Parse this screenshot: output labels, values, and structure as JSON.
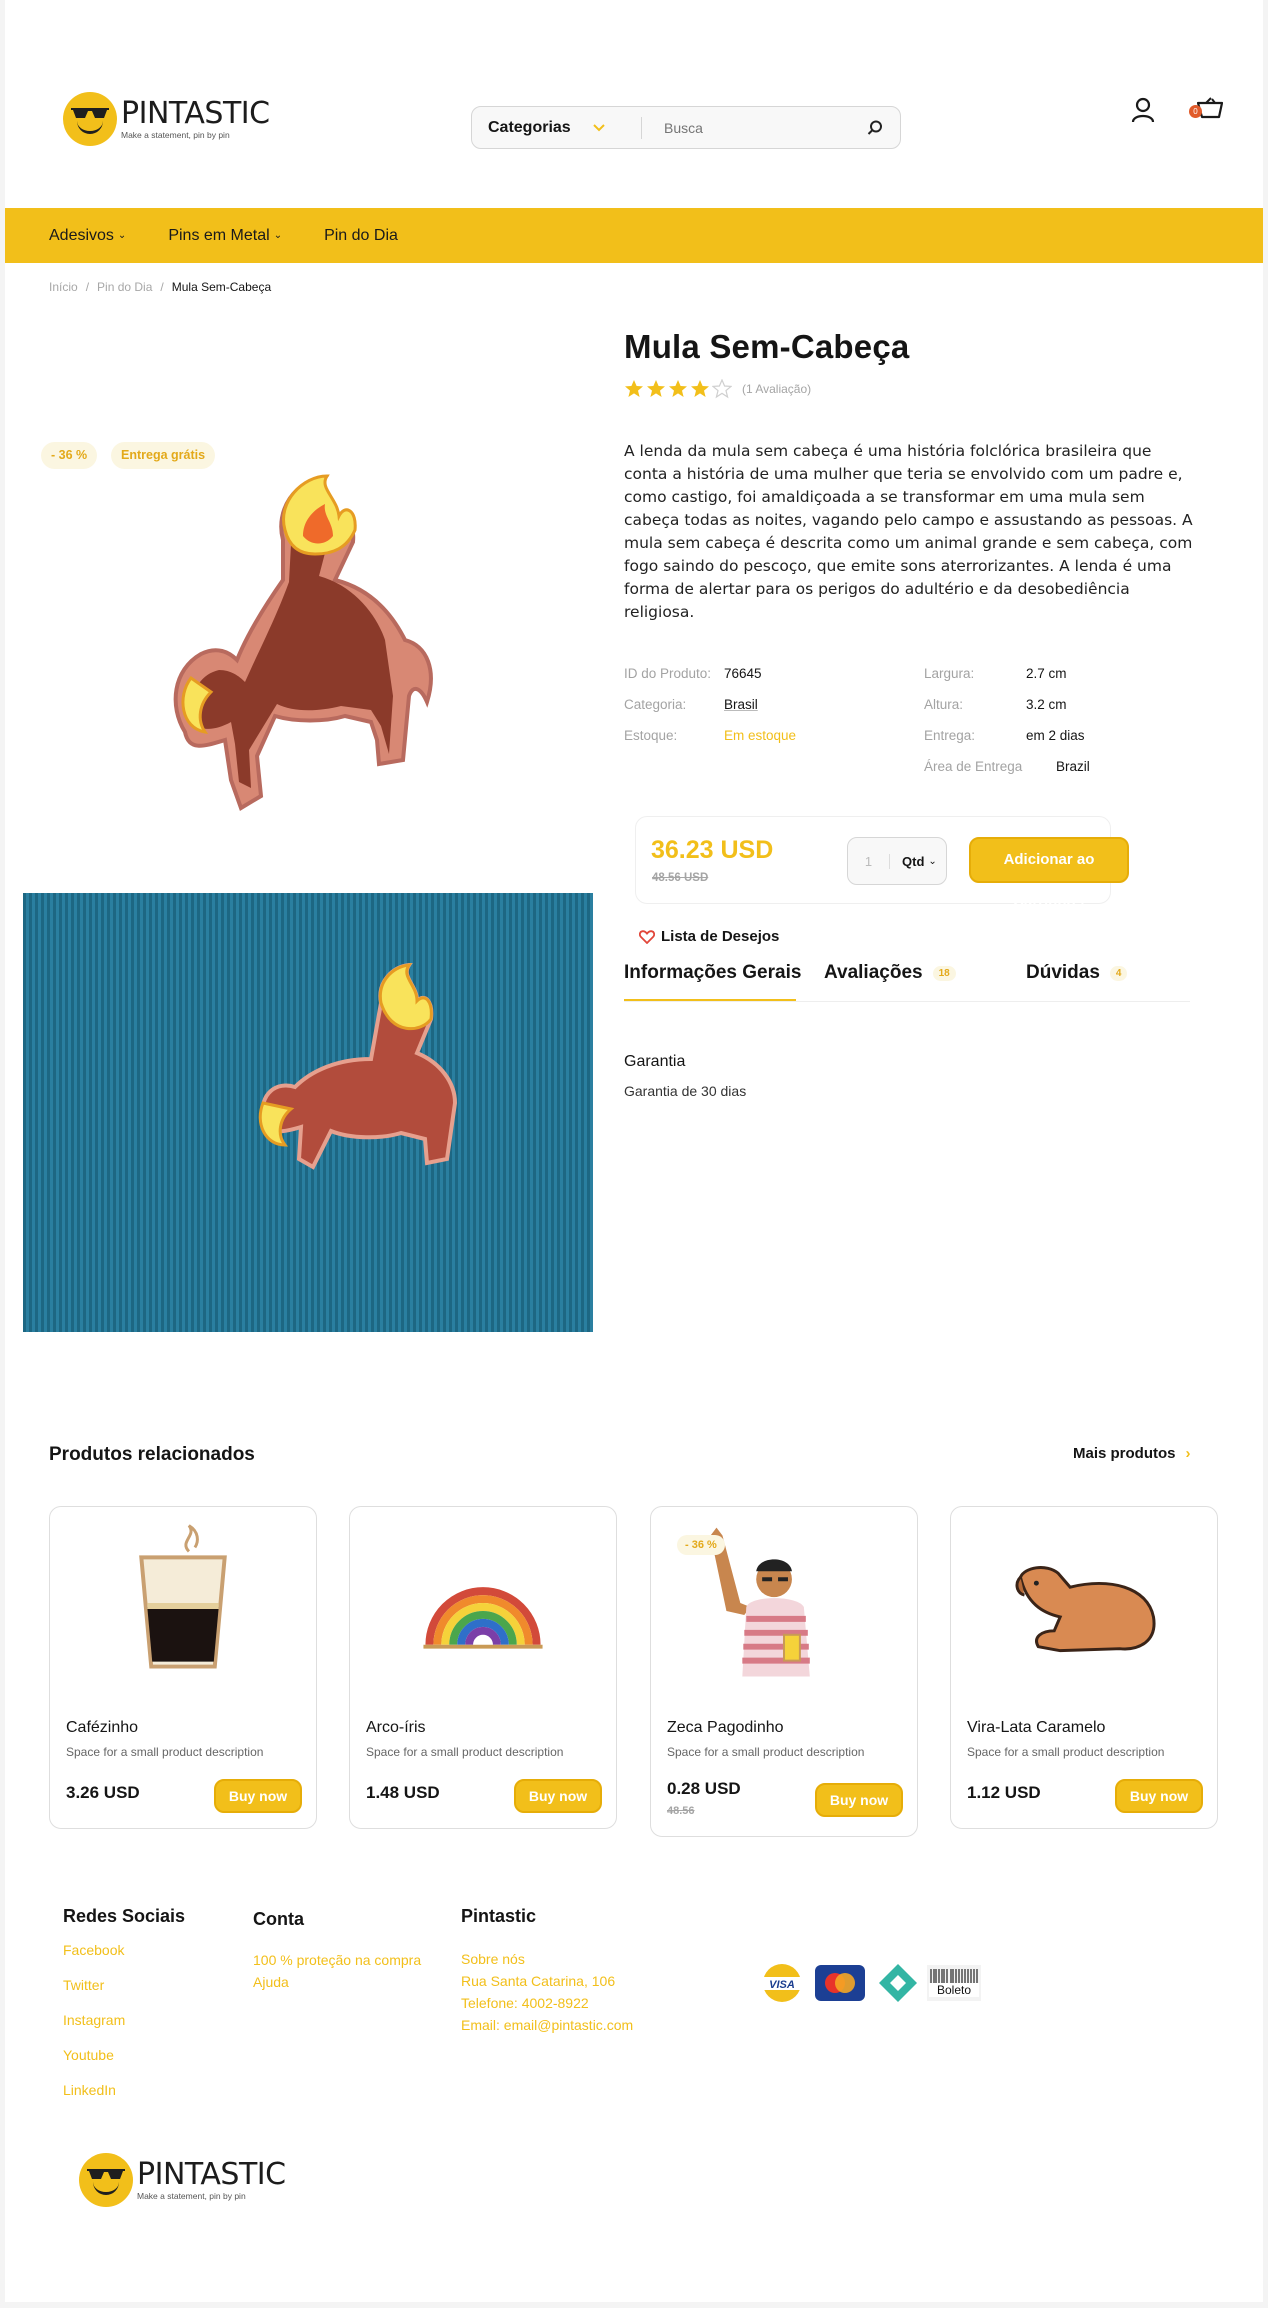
{
  "header": {
    "logo_name": "PINTASTIC",
    "logo_tagline": "Make a statement, pin by pin",
    "search_category": "Categorias",
    "search_placeholder": "Busca",
    "cart_count": "0"
  },
  "nav": {
    "items": [
      "Adesivos",
      "Pins em Metal",
      "Pin do Dia"
    ]
  },
  "breadcrumb": [
    "Início",
    "Pin do Dia",
    "Mula Sem-Cabeça"
  ],
  "product": {
    "discount_badge": "- 36 %",
    "shipping_badge": "Entrega grátis",
    "title": "Mula Sem-Cabeça",
    "rating": 4,
    "rating_max": 5,
    "rating_count": "(1 Avaliação)",
    "description": "A lenda da mula sem cabeça é uma história folclórica brasileira que conta a história de uma mulher que teria se envolvido com um padre e, como castigo, foi amaldiçoada a se transformar em uma mula sem cabeça todas as noites, vagando pelo campo e assustando as pessoas. A mula sem cabeça é descrita como um animal grande e sem cabeça, com fogo saindo do pescoço, que emite sons aterrorizantes. A lenda é uma forma de alertar para os perigos do adultério e da desobediência religiosa.",
    "specs_left": [
      {
        "key": "ID do Produto:",
        "value": "76645"
      },
      {
        "key": "Categoria:",
        "value": "Brasil"
      },
      {
        "key": "Estoque:",
        "value": "Em estoque"
      }
    ],
    "specs_right": [
      {
        "key": "Largura:",
        "value": "2.7 cm"
      },
      {
        "key": "Altura:",
        "value": "3.2 cm"
      },
      {
        "key": "Entrega:",
        "value": "em 2 dias"
      },
      {
        "key": "Área de Entrega",
        "value": "Brazil"
      }
    ],
    "price": "36.23 USD",
    "old_price": "48.56 USD",
    "qty_value": "1",
    "qty_unit": "Qtd",
    "add_to_cart": "Adicionar ao Carrinho",
    "wishlist": "Lista de Desejos"
  },
  "tabs": [
    {
      "label": "Informações Gerais",
      "count": ""
    },
    {
      "label": "Avaliações",
      "count": "18"
    },
    {
      "label": "Dúvidas",
      "count": "4"
    }
  ],
  "general_info": {
    "title": "Garantia",
    "text": "Garantia de 30 dias"
  },
  "related": {
    "title": "Produtos relacionados",
    "more_label": "Mais produtos",
    "products": [
      {
        "name": "Cafézinho",
        "desc": "Space for a small product description",
        "price": "3.26 USD",
        "old_price": "",
        "badge": "",
        "button": "Buy now"
      },
      {
        "name": "Arco-íris",
        "desc": "Space for a small product description",
        "price": "1.48 USD",
        "old_price": "",
        "badge": "",
        "button": "Buy now"
      },
      {
        "name": "Zeca Pagodinho",
        "desc": "Space for a small product description",
        "price": "0.28 USD",
        "old_price": "48.56",
        "badge": "- 36 %",
        "button": "Buy now"
      },
      {
        "name": "Vira-Lata Caramelo",
        "desc": "Space for a small product description",
        "price": "1.12 USD",
        "old_price": "",
        "badge": "",
        "button": "Buy now"
      }
    ]
  },
  "footer": {
    "social_title": "Redes Sociais",
    "social_links": [
      "Facebook",
      "Twitter",
      "Instagram",
      "Youtube",
      "LinkedIn"
    ],
    "account_title": "Conta",
    "account_links": [
      "100 % proteção na compra",
      "Ajuda"
    ],
    "company_title": "Pintastic",
    "company_links": [
      "Sobre nós",
      "Rua Santa Catarina, 106",
      "Telefone: 4002-8922",
      "Email: email@pintastic.com"
    ],
    "payment_methods": [
      "VISA",
      "Boleto"
    ]
  },
  "colors": {
    "brand_yellow": "#f2bf1a",
    "badge_bg": "#fbf6e1",
    "cart_badge": "#e15b2a",
    "knit_blue": "#1f6b86"
  }
}
